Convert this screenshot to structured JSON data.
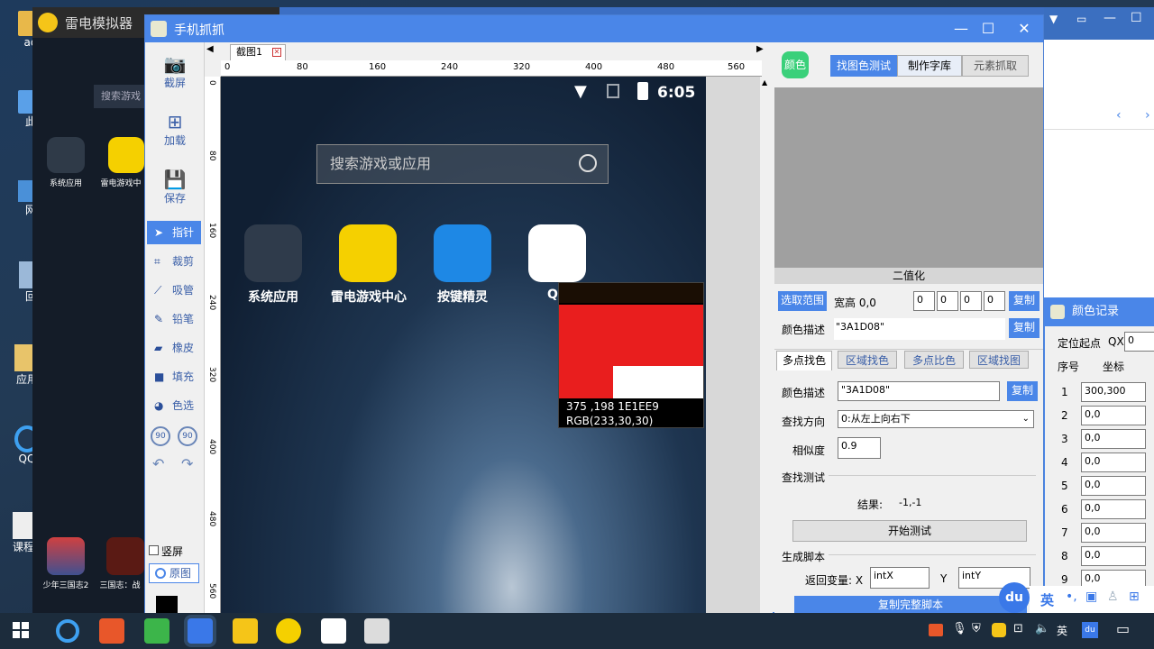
{
  "emulator": {
    "title": "雷电模拟器",
    "search_placeholder": "搜索游戏",
    "apps": [
      "系统应用",
      "雷电游戏中"
    ],
    "bottom_apps": [
      "少年三国志2",
      "三国志：战"
    ]
  },
  "desktop_icons": [
    "ad",
    "此",
    "网",
    "回",
    "应用",
    "QQ",
    "课程"
  ],
  "window": {
    "title": "手机抓抓",
    "controls": [
      "—",
      "☐",
      "✕"
    ]
  },
  "left_tools": {
    "top": [
      {
        "label": "截屏",
        "icon": "camera-icon"
      },
      {
        "label": "加载",
        "icon": "add-file-icon"
      },
      {
        "label": "保存",
        "icon": "save-icon"
      }
    ],
    "items": [
      {
        "label": "指针",
        "icon": "pointer-icon",
        "glyph": "➤"
      },
      {
        "label": "裁剪",
        "icon": "crop-icon",
        "glyph": "⌗"
      },
      {
        "label": "吸管",
        "icon": "eyedropper-icon",
        "glyph": "⟋"
      },
      {
        "label": "铅笔",
        "icon": "pencil-icon",
        "glyph": "✎"
      },
      {
        "label": "橡皮",
        "icon": "eraser-icon",
        "glyph": "▰"
      },
      {
        "label": "填充",
        "icon": "fill-icon",
        "glyph": "■"
      },
      {
        "label": "色选",
        "icon": "palette-icon",
        "glyph": "◕"
      }
    ],
    "rotate_left": "90",
    "rotate_right": "90",
    "portrait_label": "竖屏",
    "original_label": "原图"
  },
  "canvas": {
    "tab_label": "截图1",
    "ruler_h": [
      "0",
      "80",
      "160",
      "240",
      "320",
      "400",
      "480",
      "560"
    ],
    "ruler_v": [
      "0",
      "80",
      "160",
      "240",
      "320",
      "400",
      "480",
      "560"
    ],
    "time": "6:05",
    "search_placeholder": "搜索游戏或应用",
    "apps": [
      "系统应用",
      "雷电游戏中心",
      "按键精灵",
      "Q"
    ],
    "magnifier_coord": "375 ,198  1E1EE9",
    "magnifier_rgb": "RGB(233,30,30)"
  },
  "right_panel": {
    "color_label": "颜色",
    "tabs": [
      "找图色测试",
      "制作字库",
      "元素抓取"
    ],
    "binarize_label": "二值化",
    "select_range_btn": "选取范围",
    "wh_label": "宽高 0,0",
    "range_inputs": [
      "0",
      "0",
      "0",
      "0"
    ],
    "copy_label": "复制",
    "color_desc_label": "颜色描述",
    "color_desc_value": "\"3A1D08\"",
    "sub_tabs": [
      "多点找色",
      "区域找色",
      "多点比色",
      "区域找图"
    ],
    "find_dir_label": "查找方向",
    "find_dir_value": "0:从左上向右下",
    "similarity_label": "相似度",
    "similarity_value": "0.9",
    "find_test_label": "查找测试",
    "result_label": "结果:",
    "result_value": "-1,-1",
    "start_test_btn": "开始测试",
    "gen_script_label": "生成脚本",
    "return_var_label": "返回变量: X",
    "var_x": "intX",
    "y_label": "Y",
    "var_y": "intY",
    "copy_script_btn": "复制完整脚本"
  },
  "color_record": {
    "title": "颜色记录",
    "origin_label": "定位起点",
    "qx_label": "QX",
    "qx_value": "0",
    "col_seq": "序号",
    "col_coord": "坐标",
    "rows": [
      {
        "n": "1",
        "v": "300,300"
      },
      {
        "n": "2",
        "v": "0,0"
      },
      {
        "n": "3",
        "v": "0,0"
      },
      {
        "n": "4",
        "v": "0,0"
      },
      {
        "n": "5",
        "v": "0,0"
      },
      {
        "n": "6",
        "v": "0,0"
      },
      {
        "n": "7",
        "v": "0,0"
      },
      {
        "n": "8",
        "v": "0,0"
      },
      {
        "n": "9",
        "v": "0,0"
      }
    ]
  },
  "ime": {
    "logo": "du",
    "lang": "英"
  },
  "tray": {
    "lang": "英",
    "time": ""
  },
  "colors": {
    "accent": "#4a86e8",
    "title": "#4a86e8",
    "magnifier_red": "#e91e1e"
  }
}
